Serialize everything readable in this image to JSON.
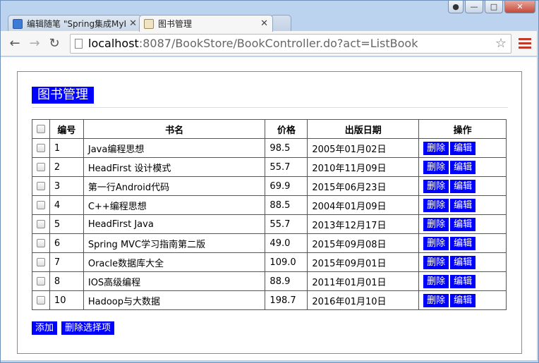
{
  "browser": {
    "tabs": [
      {
        "title": "编辑随笔 \"Spring集成MyI",
        "active": false
      },
      {
        "title": "图书管理",
        "active": true
      }
    ],
    "url_host": "localhost",
    "url_path": ":8087/BookStore/BookController.do?act=ListBook"
  },
  "page": {
    "title": "图书管理",
    "table": {
      "headers": [
        "编号",
        "书名",
        "价格",
        "出版日期",
        "操作"
      ],
      "rows": [
        {
          "id": "1",
          "name": "Java编程思想",
          "price": "98.5",
          "date": "2005年01月02日"
        },
        {
          "id": "2",
          "name": "HeadFirst 设计模式",
          "price": "55.7",
          "date": "2010年11月09日"
        },
        {
          "id": "3",
          "name": "第一行Android代码",
          "price": "69.9",
          "date": "2015年06月23日"
        },
        {
          "id": "4",
          "name": "C++编程思想",
          "price": "88.5",
          "date": "2004年01月09日"
        },
        {
          "id": "5",
          "name": "HeadFirst Java",
          "price": "55.7",
          "date": "2013年12月17日"
        },
        {
          "id": "6",
          "name": "Spring MVC学习指南第二版",
          "price": "49.0",
          "date": "2015年09月08日"
        },
        {
          "id": "7",
          "name": "Oracle数据库大全",
          "price": "109.0",
          "date": "2015年09月01日"
        },
        {
          "id": "8",
          "name": "IOS高级编程",
          "price": "88.9",
          "date": "2011年01月01日"
        },
        {
          "id": "10",
          "name": "Hadoop与大数据",
          "price": "198.7",
          "date": "2016年01月10日"
        }
      ],
      "delete_label": "删除",
      "edit_label": "编辑"
    },
    "actions": {
      "add_label": "添加",
      "delete_selected_label": "删除选择项"
    }
  },
  "colors": {
    "button_bg": "#0000ff",
    "button_text": "#ffffff"
  }
}
